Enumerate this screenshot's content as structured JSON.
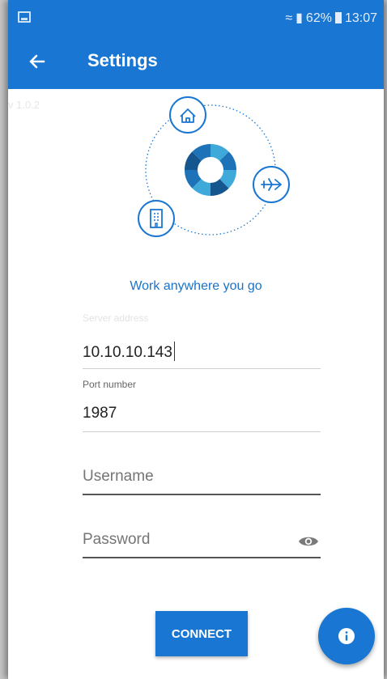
{
  "status_bar": {
    "battery": "62%",
    "time": "13:07"
  },
  "app_bar": {
    "title": "Settings"
  },
  "version": "v 1.0.2",
  "tagline": "Work anywhere you go",
  "form": {
    "server": {
      "label": "Server address",
      "value": "10.10.10.143"
    },
    "port": {
      "label": "Port number",
      "value": "1987"
    },
    "username": {
      "placeholder": "Username"
    },
    "password": {
      "placeholder": "Password"
    }
  },
  "connect_label": "CONNECT",
  "colors": {
    "primary": "#1976d2",
    "accent_text": "#1a73c8"
  },
  "icons": {
    "back": "arrow-left-icon",
    "home": "home-icon",
    "plane": "airplane-icon",
    "building": "building-icon",
    "eye": "eye-icon",
    "info": "info-icon"
  }
}
